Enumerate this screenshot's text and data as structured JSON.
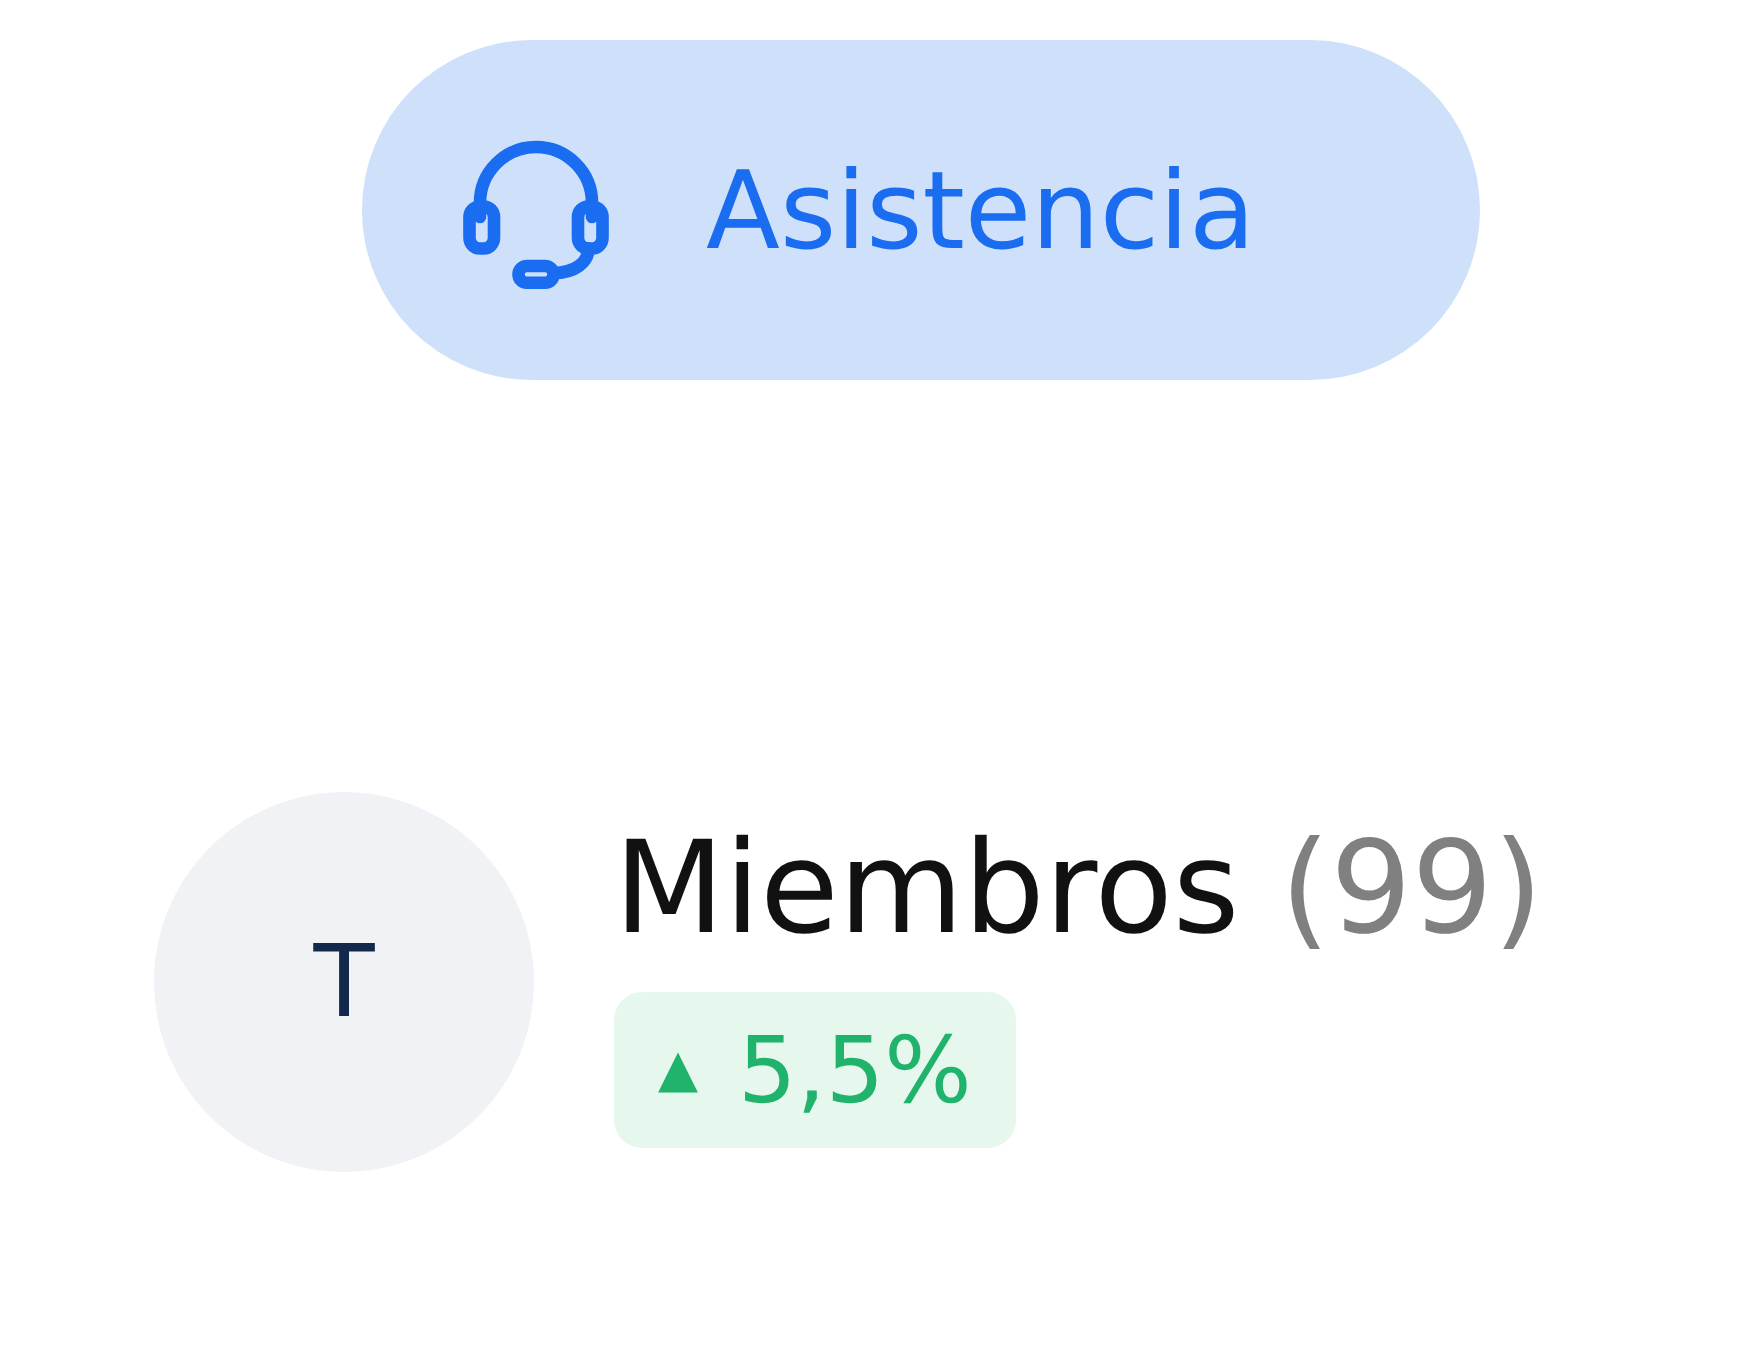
{
  "support_button": {
    "label": "Asistencia"
  },
  "member": {
    "avatar": "T",
    "title": "Miembros",
    "count": "(99)",
    "change": {
      "increase": true,
      "arrow": "▲",
      "value": "5,5%"
    }
  }
}
